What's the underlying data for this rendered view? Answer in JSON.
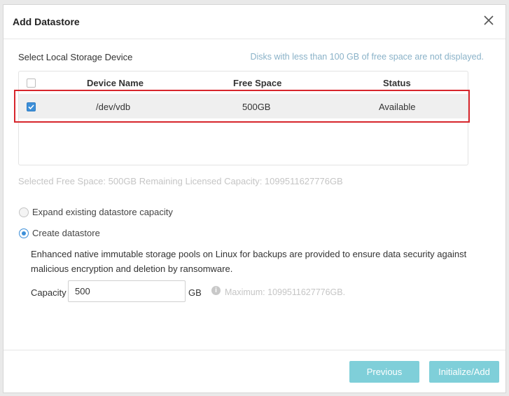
{
  "dialog": {
    "title": "Add Datastore"
  },
  "storage": {
    "section_label": "Select Local Storage Device",
    "hint": "Disks with less than 100 GB of free space are not displayed.",
    "columns": {
      "device_name": "Device Name",
      "free_space": "Free Space",
      "status": "Status"
    },
    "rows": [
      {
        "device": "/dev/vdb",
        "free_space": "500GB",
        "status": "Available",
        "checked": true
      }
    ]
  },
  "summary": "Selected Free Space: 500GB Remaining Licensed Capacity: 1099511627776GB",
  "options": {
    "expand_label": "Expand existing datastore capacity",
    "create_label": "Create datastore",
    "selected": "create"
  },
  "description": "Enhanced native immutable storage pools on Linux for backups are provided to ensure data security against malicious encryption and deletion by ransomware.",
  "capacity": {
    "label": "Capacity",
    "value": "500",
    "unit": "GB",
    "maximum": "Maximum: 1099511627776GB."
  },
  "footer": {
    "previous_label": "Previous",
    "initialize_label": "Initialize/Add"
  },
  "colors": {
    "accent": "#3d8fd8",
    "button": "#7fcfd9",
    "highlight_border": "#d7262c"
  },
  "icons": {
    "close": "close-icon",
    "info": "info-icon",
    "checkbox": "checkbox-icon"
  }
}
